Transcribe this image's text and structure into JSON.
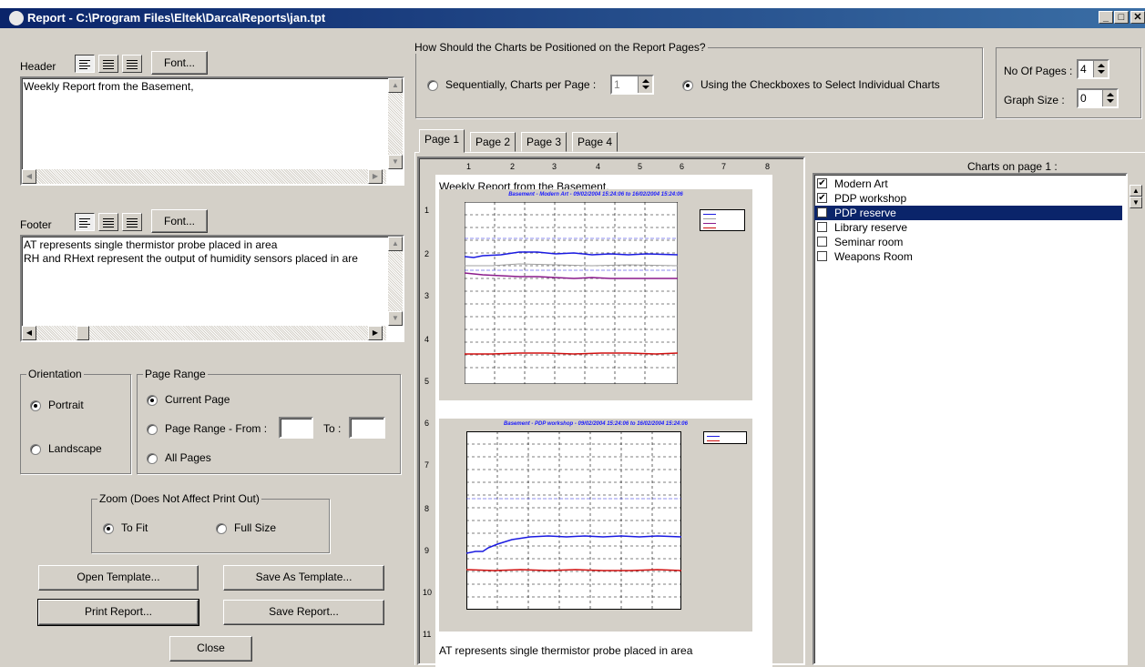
{
  "window": {
    "title": "Report - C:\\Program Files\\Eltek\\Darca\\Reports\\jan.tpt",
    "minimize": "_",
    "maximize": "□",
    "close": "✕"
  },
  "header": {
    "label": "Header",
    "font_button": "Font...",
    "text": "Weekly Report from the Basement,"
  },
  "footer": {
    "label": "Footer",
    "font_button": "Font...",
    "text_line1": "AT represents single thermistor probe placed in area",
    "text_line2": "RH and RHext represent the output of humidity sensors placed in are"
  },
  "orientation": {
    "label": "Orientation",
    "portrait": "Portrait",
    "landscape": "Landscape",
    "selected": "Portrait"
  },
  "page_range": {
    "label": "Page Range",
    "current": "Current Page",
    "range_from": "Page Range - From :",
    "to": "To :",
    "all": "All Pages",
    "from_value": "",
    "to_value": ""
  },
  "zoom": {
    "label": "Zoom (Does Not Affect Print Out)",
    "to_fit": "To Fit",
    "full_size": "Full Size",
    "selected": "To Fit"
  },
  "buttons": {
    "open_template": "Open Template...",
    "save_as_template": "Save As Template...",
    "print_report": "Print Report...",
    "save_report": "Save Report...",
    "close": "Close"
  },
  "positioning": {
    "label": "How Should the Charts be Positioned on the Report Pages?",
    "sequential": "Sequentially, Charts per Page :",
    "sequential_value": "1",
    "checkboxes": "Using the Checkboxes to Select Individual Charts",
    "selected": "checkboxes"
  },
  "pages": {
    "no_of_pages_label": "No Of Pages :",
    "no_of_pages_value": "4",
    "graph_size_label": "Graph Size :",
    "graph_size_value": "0"
  },
  "tabs": [
    "Page 1",
    "Page 2",
    "Page 3",
    "Page 4"
  ],
  "active_tab": "Page 1",
  "charts_list": {
    "title": "Charts on page 1 :",
    "items": [
      {
        "label": "Modern Art",
        "checked": true,
        "selected": false
      },
      {
        "label": "PDP workshop",
        "checked": true,
        "selected": false
      },
      {
        "label": "PDP reserve",
        "checked": false,
        "selected": true
      },
      {
        "label": "Library reserve",
        "checked": false,
        "selected": false
      },
      {
        "label": "Seminar room",
        "checked": false,
        "selected": false
      },
      {
        "label": "Weapons Room",
        "checked": false,
        "selected": false
      }
    ]
  },
  "preview": {
    "ruler_top": [
      "1",
      "2",
      "3",
      "4",
      "5",
      "6",
      "7",
      "8"
    ],
    "ruler_left": [
      "1",
      "2",
      "3",
      "4",
      "5",
      "6",
      "7",
      "8",
      "9",
      "10",
      "11"
    ],
    "header_text": "Weekly Report from the Basement,",
    "footer_text": "AT represents single thermistor probe placed in area",
    "chart1_title": "Basement - Modern Art - 09/02/2004 15:24:06 to 16/02/2004 15:24:06",
    "chart2_title": "Basement - PDP workshop - 09/02/2004 15:24:06 to 16/02/2004 15:24:06"
  },
  "colors": {
    "title_bar": "#0a246a",
    "selection": "#0a246a",
    "dialog_bg": "#d4d0c8",
    "series_blue": "#1a1ae0",
    "series_red": "#d01010",
    "series_purple": "#8b1a8b",
    "series_grey": "#a0a0a0"
  }
}
